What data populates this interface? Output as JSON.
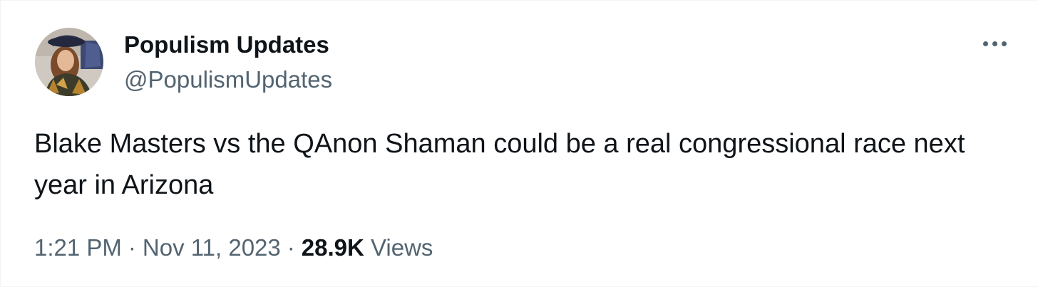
{
  "author": {
    "display_name": "Populism Updates",
    "handle": "@PopulismUpdates",
    "avatar_icon": "profile-photo"
  },
  "more_icon": "more-horizontal-icon",
  "tweet": {
    "text": "Blake Masters vs the QAnon Shaman could be a real congressional race next year in Arizona",
    "time": "1:21 PM",
    "date": "Nov 11, 2023",
    "separator": "·",
    "views_count": "28.9K",
    "views_label": "Views"
  },
  "colors": {
    "text_primary": "#0f1419",
    "text_secondary": "#536471",
    "background": "#ffffff"
  }
}
